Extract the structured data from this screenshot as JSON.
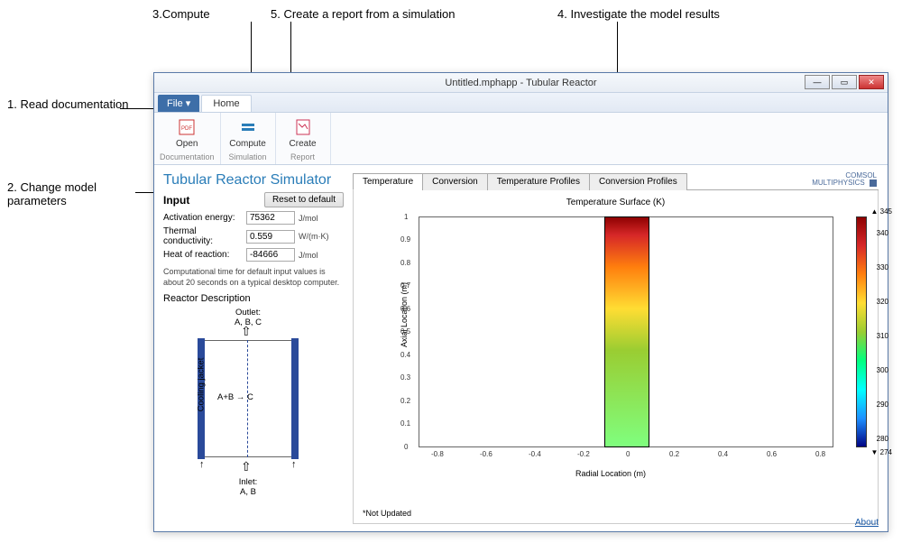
{
  "annotations": {
    "a1": "1. Read documentation",
    "a2": "2. Change model parameters",
    "a3": "3.Compute",
    "a4": "4. Investigate the model results",
    "a5": "5. Create a report from a simulation"
  },
  "window": {
    "title": "Untitled.mphapp - Tubular Reactor"
  },
  "menu": {
    "file": "File ▾",
    "home": "Home"
  },
  "ribbon": {
    "open": "Open",
    "compute": "Compute",
    "create": "Create",
    "g1": "Documentation",
    "g2": "Simulation",
    "g3": "Report"
  },
  "brand": {
    "l1": "COMSOL",
    "l2": "MULTIPHYSICS"
  },
  "app": {
    "title": "Tubular Reactor Simulator",
    "input_title": "Input",
    "reset": "Reset to default",
    "params": [
      {
        "label": "Activation energy:",
        "value": "75362",
        "unit": "J/mol"
      },
      {
        "label": "Thermal conductivity:",
        "value": "0.559",
        "unit": "W/(m·K)"
      },
      {
        "label": "Heat of reaction:",
        "value": "-84666",
        "unit": "J/mol"
      }
    ],
    "note": "Computational time for default input values is about 20 seconds on a typical desktop computer.",
    "diag_title": "Reactor Description",
    "outlet": "Outlet:\nA, B, C",
    "inlet": "Inlet:\nA, B",
    "jacket": "Cooling jacket",
    "reaction": "A+B → C"
  },
  "tabs": [
    "Temperature",
    "Conversion",
    "Temperature Profiles",
    "Conversion Profiles"
  ],
  "plot": {
    "title": "Temperature Surface (K)",
    "ylabel": "Axial Location (m)",
    "xlabel": "Radial Location (m)",
    "yticks": [
      "0",
      "0.1",
      "0.2",
      "0.3",
      "0.4",
      "0.5",
      "0.6",
      "0.7",
      "0.8",
      "0.9",
      "1"
    ],
    "xticks": [
      "-0.8",
      "-0.6",
      "-0.4",
      "-0.2",
      "0",
      "0.2",
      "0.4",
      "0.6",
      "0.8"
    ],
    "cbar_ticks": [
      "340",
      "330",
      "320",
      "310",
      "300",
      "290",
      "280"
    ],
    "cbar_max": "▲ 345",
    "cbar_min": "▼ 274",
    "not_updated": "*Not Updated"
  },
  "chart_data": {
    "type": "heatmap",
    "title": "Temperature Surface (K)",
    "xlabel": "Radial Location (m)",
    "ylabel": "Axial Location (m)",
    "xlim": [
      -0.9,
      0.9
    ],
    "ylim": [
      0,
      1
    ],
    "zlim": [
      274,
      345
    ],
    "colorbar_label": "K",
    "field_extent_x": [
      -0.1,
      0.1
    ],
    "field_extent_y": [
      0,
      1
    ],
    "approximate_axial_profile": [
      {
        "y": 0.0,
        "T": 300
      },
      {
        "y": 0.2,
        "T": 307
      },
      {
        "y": 0.4,
        "T": 315
      },
      {
        "y": 0.6,
        "T": 326
      },
      {
        "y": 0.8,
        "T": 336
      },
      {
        "y": 1.0,
        "T": 345
      }
    ]
  },
  "about": "About"
}
